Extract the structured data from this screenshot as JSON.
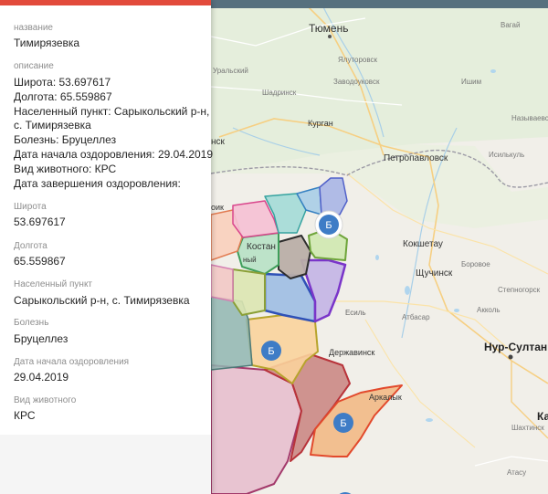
{
  "panel": {
    "name_label": "название",
    "name_value": "Тимирязевка",
    "description_label": "описание",
    "description_lines": [
      "Широта: 53.697617",
      "Долгота: 65.559867",
      "Населенный пункт: Сарыкольский р-н,",
      "с. Тимирязевка",
      "Болезнь: Бруцеллез",
      "Дата начала оздоровления: 29.04.2019",
      "Вид животного: КРС",
      "Дата завершения оздоровления:"
    ],
    "lat_label": "Широта",
    "lat_value": "53.697617",
    "lon_label": "Долгота",
    "lon_value": "65.559867",
    "settlement_label": "Населенный пункт",
    "settlement_value": "Сарыкольский р-н, с. Тимирязевка",
    "disease_label": "Болезнь",
    "disease_value": "Бруцеллез",
    "start_date_label": "Дата начала оздоровления",
    "start_date_value": "29.04.2019",
    "animal_label": "Вид животного",
    "animal_value": "КРС"
  },
  "map": {
    "cities": {
      "tyumen": "Тюмень",
      "yalutorovsk": "Ялуторовск",
      "zavodoukovsk": "Заводоуковск",
      "shadrinsk": "Шадринск",
      "kurgan": "Курган",
      "petropavlovsk": "Петропавловск",
      "kokshetau": "Кокшетау",
      "schuchinsk": "Щучинск",
      "kostanay": "Костан",
      "nur_sultan": "Нур-Султан",
      "derzhavinsk": "Державинск",
      "arkalyk": "Аркалык",
      "esil": "Есиль",
      "atbasar": "Атбасар",
      "borovoe": "Боровое",
      "stepnogorsk": "Степногорск",
      "ishim": "Ишим",
      "isilkul": "Исилькуль",
      "nazyvaevsk": "Называевск",
      "uralsky": "Уральский",
      "vagay": "Вагай",
      "nsk": "нск",
      "rudny": "ный",
      "akkol": "Акколь",
      "shakhtinsk": "Шахтинск",
      "atasu": "Атасу",
      "karaganda": "Ка",
      "pik": "оик"
    },
    "marker_label": "Б",
    "colors": {
      "marker": "#3e7cc6",
      "header": "#e24a3b",
      "topbar": "#56707e"
    }
  }
}
